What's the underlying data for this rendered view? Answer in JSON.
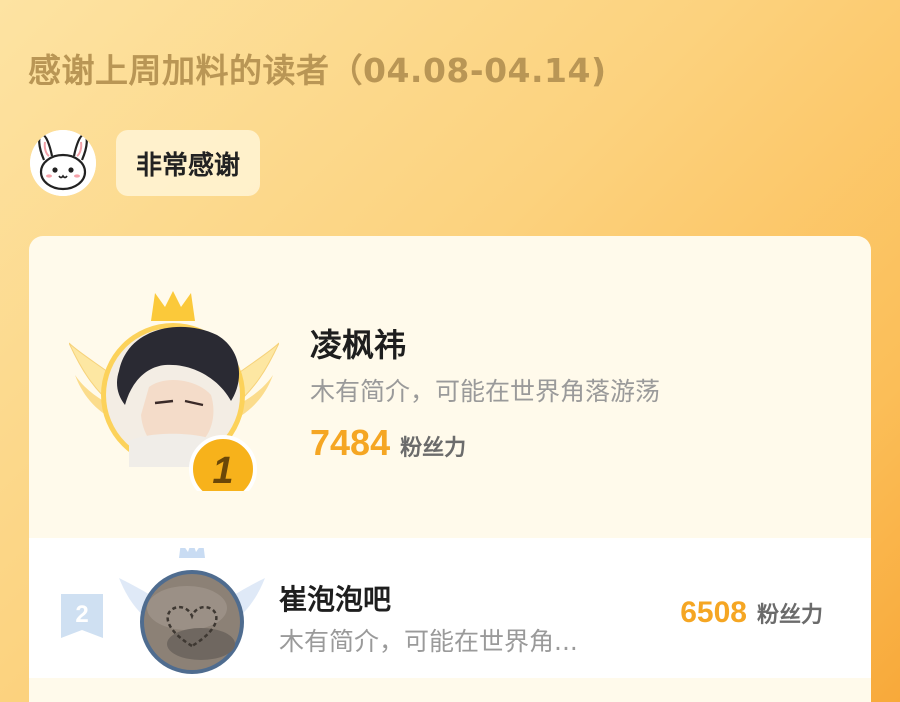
{
  "header": {
    "title": "感谢上周加料的读者（04.08-04.14)"
  },
  "thanks": {
    "mascot_icon": "bunny-face-icon",
    "message": "非常感谢"
  },
  "colors": {
    "accent": "#f5a623",
    "title": "#b99655"
  },
  "leaderboard": {
    "first": {
      "rank": "1",
      "name": "凌枫祎",
      "description": "木有简介，可能在世界角落游荡",
      "score": "7484",
      "score_unit": "粉丝力",
      "decoration_icon": "crown-wings-icon"
    },
    "second": {
      "rank": "2",
      "name": "崔泡泡吧",
      "description": "木有简介，可能在世界角...",
      "score": "6508",
      "score_unit": "粉丝力",
      "decoration_icon": "crown-wings-icon"
    }
  }
}
